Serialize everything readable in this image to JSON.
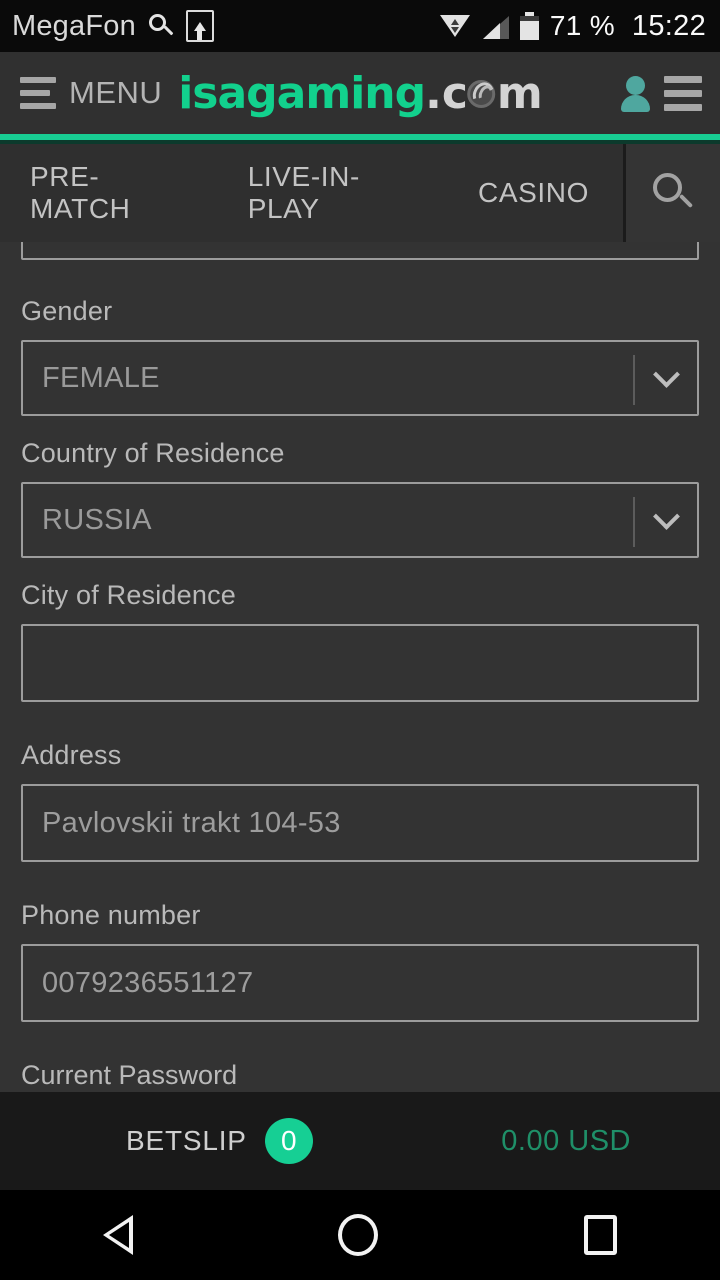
{
  "status_bar": {
    "carrier": "MegaFon",
    "search_icon": "search-icon",
    "upload_icon": "upload-arrow-icon",
    "wifi_icon": "wifi-icon",
    "signal_icon": "cell-signal-icon",
    "battery_icon": "battery-icon",
    "battery_percent": "71 %",
    "clock": "15:22"
  },
  "header": {
    "menu_label": "MENU",
    "menu_icon": "hamburger-icon",
    "logo": {
      "main": "isagaming",
      "dot": ".",
      "c": "c",
      "m": "m",
      "full_text": "isagaming.com",
      "color": "#12d18d",
      "suffix_color": "#d3d3d3"
    },
    "account_icon": "user-account-icon",
    "nav_icon": "hamburger-icon",
    "accent_color": "#18cd93"
  },
  "nav_tabs": {
    "items": [
      {
        "label": "PRE-MATCH",
        "name": "tab-pre-match"
      },
      {
        "label": "LIVE-IN-PLAY",
        "name": "tab-live-in-play"
      },
      {
        "label": "CASINO",
        "name": "tab-casino"
      }
    ],
    "search_icon": "search-icon"
  },
  "form": {
    "fields": [
      {
        "label": "Gender",
        "value": "FEMALE",
        "type": "select",
        "name": "gender"
      },
      {
        "label": "Country of Residence",
        "value": "RUSSIA",
        "type": "select",
        "name": "country-of-residence"
      },
      {
        "label": "City of Residence",
        "value": "",
        "type": "text",
        "name": "city-of-residence"
      },
      {
        "label": "Address",
        "value": "Pavlovskii trakt 104-53",
        "type": "text",
        "name": "address"
      },
      {
        "label": "Phone number",
        "value": "0079236551127",
        "type": "text",
        "name": "phone-number"
      }
    ],
    "clipped_label": "Current Password"
  },
  "betslip": {
    "label": "BETSLIP",
    "count": "0",
    "amount": "0.00 USD",
    "badge_color": "#16cf94",
    "amount_color": "#1f8f68"
  },
  "android_nav": {
    "back": "back-icon",
    "home": "home-icon",
    "recents": "recent-apps-icon"
  }
}
